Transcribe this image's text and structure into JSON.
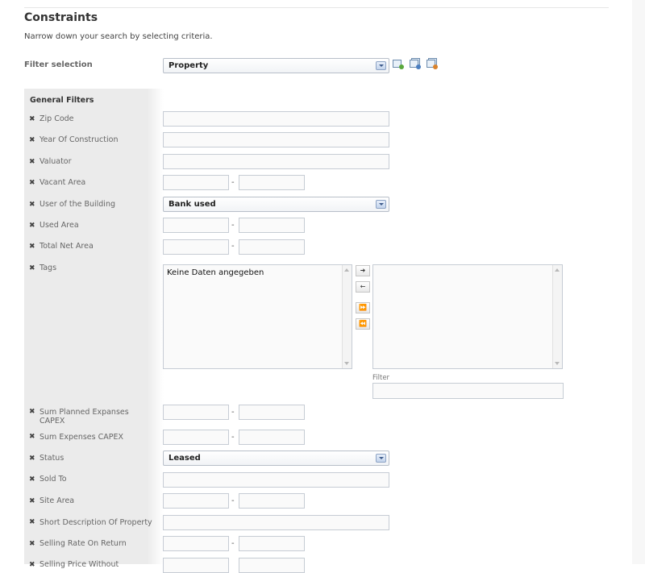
{
  "page": {
    "title": "Constraints",
    "subtitle": "Narrow down your search by selecting criteria."
  },
  "filter_selection": {
    "label": "Filter selection",
    "value": "Property",
    "icons": [
      "filter-add-icon",
      "filter-save-icon",
      "filter-delete-icon"
    ]
  },
  "general_filters": {
    "title": "General Filters",
    "remove_glyph": "✖",
    "range_separator": "-",
    "rows": [
      {
        "label": "Zip Code"
      },
      {
        "label": "Year Of Construction"
      },
      {
        "label": "Valuator"
      },
      {
        "label": "Vacant Area"
      },
      {
        "label": "User of the Building",
        "value": "Bank used"
      },
      {
        "label": "Used Area"
      },
      {
        "label": "Total Net Area"
      },
      {
        "label": "Tags"
      },
      {
        "label": "Sum Planned Expanses CAPEX"
      },
      {
        "label": "Sum Expenses CAPEX"
      },
      {
        "label": "Status",
        "value": "Leased"
      },
      {
        "label": "Sold To"
      },
      {
        "label": "Site Area"
      },
      {
        "label": "Short Description Of Property"
      },
      {
        "label": "Selling Rate On Return"
      },
      {
        "label": "Selling Price Without"
      }
    ]
  },
  "tags": {
    "available_text": "Keine Daten angegeben",
    "buttons": [
      "➜",
      "←",
      "⏩",
      "⏪"
    ],
    "filter_label": "Filter"
  },
  "colors": {
    "panel_background": "#ebebeb",
    "input_border": "#c6ccd4",
    "select_button": "#c3d3ec"
  }
}
